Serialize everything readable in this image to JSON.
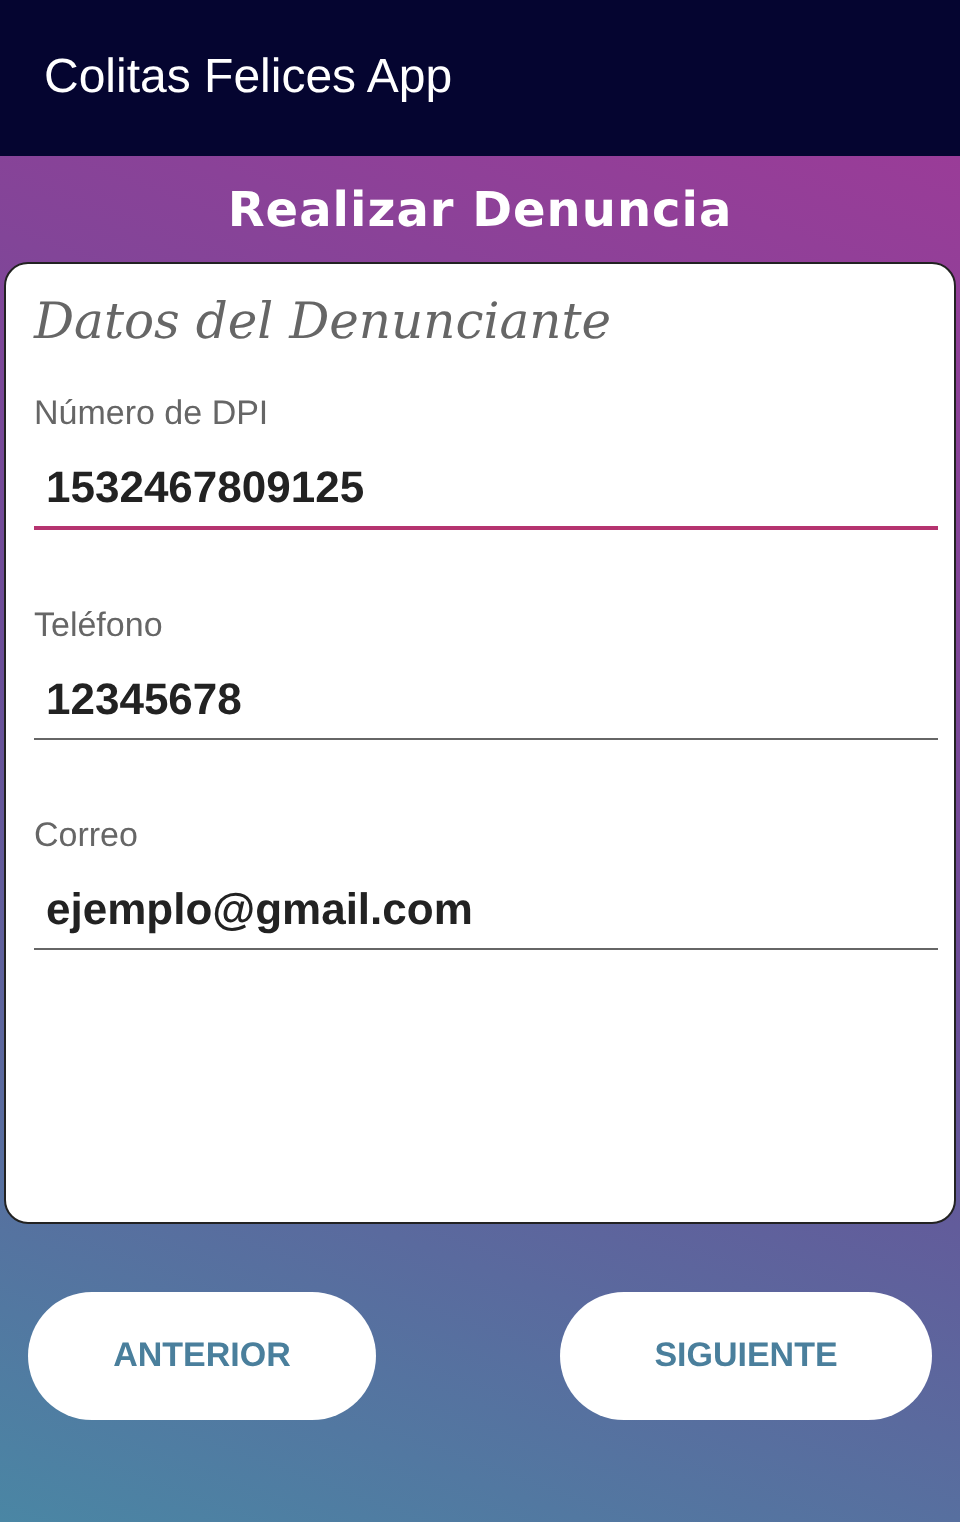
{
  "app_bar": {
    "title": "Colitas Felices App"
  },
  "page_title": "Realizar Denuncia",
  "form": {
    "heading": "Datos del Denunciante",
    "fields": [
      {
        "label": "Número de DPI",
        "value": "1532467809125",
        "focused": true
      },
      {
        "label": "Teléfono",
        "value": "12345678",
        "focused": false
      },
      {
        "label": "Correo",
        "value": "ejemplo@gmail.com",
        "focused": false
      }
    ]
  },
  "buttons": [
    {
      "label": "ANTERIOR"
    },
    {
      "label": "SIGUIENTE"
    }
  ]
}
